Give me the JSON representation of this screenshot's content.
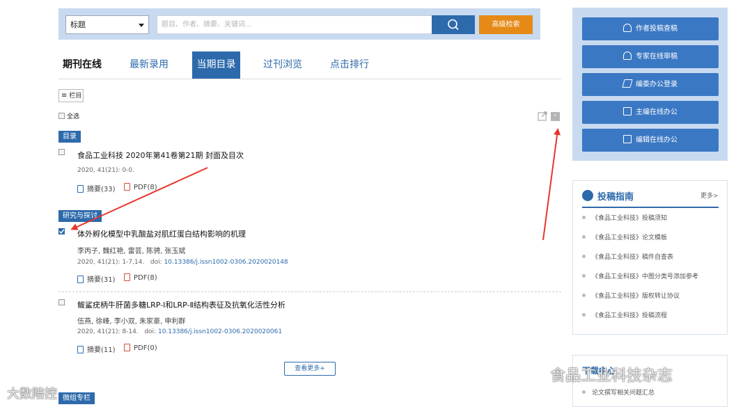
{
  "search": {
    "field_select": "标题",
    "placeholder": "题目、作者、摘要、关键词...",
    "advanced_label": "高级检索"
  },
  "tabs": [
    {
      "label": "期刊在线"
    },
    {
      "label": "最新录用"
    },
    {
      "label": "当期目录"
    },
    {
      "label": "过刊浏览"
    },
    {
      "label": "点击排行"
    }
  ],
  "toolbar": {
    "columns_label": "栏目",
    "select_all_label": "全选"
  },
  "sections": [
    {
      "tag": "目录"
    },
    {
      "tag": "研究与探讨"
    }
  ],
  "articles": [
    {
      "title": "食品工业科技 2020年第41卷第21期 封面及目次",
      "authors": "",
      "citation": "2020, 41(21): 0-0.",
      "doi_prefix": "",
      "doi": "",
      "abstract_label": "摘要(33)",
      "pdf_label": "PDF(8)",
      "checked": false
    },
    {
      "title": "体外孵化模型中乳酸盐对肌红蛋白结构影响的机理",
      "authors": "李丙子, 魏红艳, 雷芸, 陈骋, 张玉斌",
      "citation": "2020, 41(21): 1-7,14.",
      "doi_prefix": "doi:",
      "doi": "10.13386/j.issn1002-0306.2020020148",
      "abstract_label": "摘要(31)",
      "pdf_label": "PDF(8)",
      "checked": true
    },
    {
      "title": "鲅鲨疣柄牛肝菌多糖LRP-Ⅰ和LRP-Ⅱ结构表征及抗氧化活性分析",
      "authors": "伍燕, 徐峰, 李小双, 朱家豪, 申利群",
      "citation": "2020, 41(21): 8-14.",
      "doi_prefix": "doi:",
      "doi": "10.13386/j.issn1002-0306.2020020061",
      "abstract_label": "摘要(11)",
      "pdf_label": "PDF(0)",
      "checked": false
    }
  ],
  "more_button": "查看更多+",
  "right_buttons": [
    {
      "label": "作者投稿查稿"
    },
    {
      "label": "专家在线审稿"
    },
    {
      "label": "编委办公登录"
    },
    {
      "label": "主编在线办公"
    },
    {
      "label": "编辑在线办公"
    }
  ],
  "guide": {
    "title": "投稿指南",
    "more": "更多>",
    "items": [
      "《食品工业科技》投稿须知",
      "《食品工业科技》论文模板",
      "《食品工业科技》稿件自查表",
      "《食品工业科技》中图分类号添加参考",
      "《食品工业科技》版权转让协议",
      "《食品工业科技》投稿流程"
    ]
  },
  "download": {
    "title": "下载中心",
    "item": "论文撰写相关问题汇总"
  },
  "bottom_tag": "微组专栏",
  "watermark_left": "大数陪控",
  "watermark_right": "食品工业科技杂志",
  "colors": {
    "brand_blue": "#2d6aab",
    "orange": "#e58a17",
    "panel_bg": "#c8daf0",
    "arrow_red": "#e8352b"
  }
}
